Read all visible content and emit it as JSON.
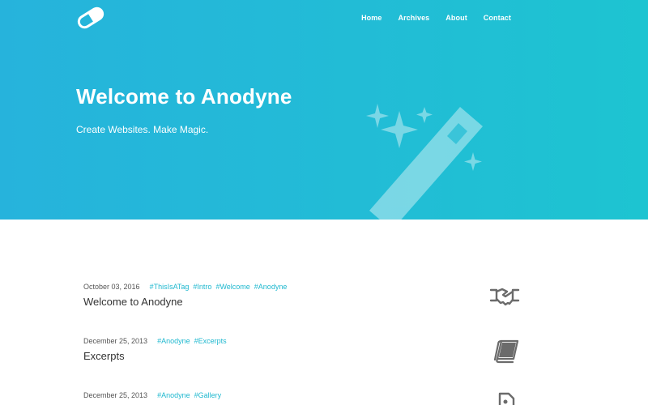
{
  "nav": {
    "links": [
      "Home",
      "Archives",
      "About",
      "Contact"
    ]
  },
  "hero": {
    "title": "Welcome to Anodyne",
    "subtitle": "Create Websites. Make Magic."
  },
  "posts": [
    {
      "date": "October 03, 2016",
      "tags": [
        "#ThisIsATag",
        "#Intro",
        "#Welcome",
        "#Anodyne"
      ],
      "title": "Welcome to Anodyne",
      "icon": "handshake-icon"
    },
    {
      "date": "December 25, 2013",
      "tags": [
        "#Anodyne",
        "#Excerpts"
      ],
      "title": "Excerpts",
      "icon": "book-icon"
    },
    {
      "date": "December 25, 2013",
      "tags": [
        "#Anodyne",
        "#Gallery"
      ],
      "title": "",
      "icon": "image-file-icon"
    }
  ],
  "colors": {
    "hero_gradient_start": "#26b3dc",
    "hero_gradient_end": "#1dc4d1",
    "tag": "#1fb8cf",
    "icon": "#6b6b6b"
  }
}
